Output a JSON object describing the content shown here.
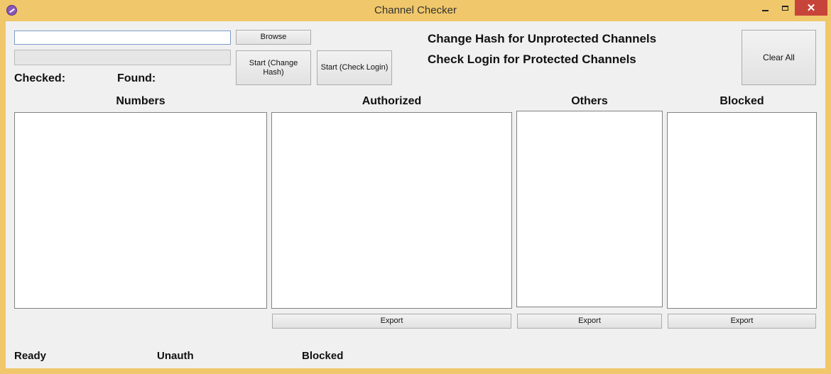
{
  "window": {
    "title": "Channel Checker"
  },
  "controls": {
    "path_value": "",
    "browse_label": "Browse",
    "start_change_hash_label": "Start (Change Hash)",
    "start_check_login_label": "Start (Check Login)",
    "clear_all_label": "Clear All",
    "checked_label": "Checked:",
    "found_label": "Found:"
  },
  "info": {
    "line1": "Change Hash for Unprotected Channels",
    "line2": "Check Login for Protected Channels"
  },
  "columns": {
    "numbers": "Numbers",
    "authorized": "Authorized",
    "others": "Others",
    "blocked": "Blocked"
  },
  "export_label": "Export",
  "status": {
    "ready": "Ready",
    "unauth": "Unauth",
    "blocked": "Blocked"
  }
}
